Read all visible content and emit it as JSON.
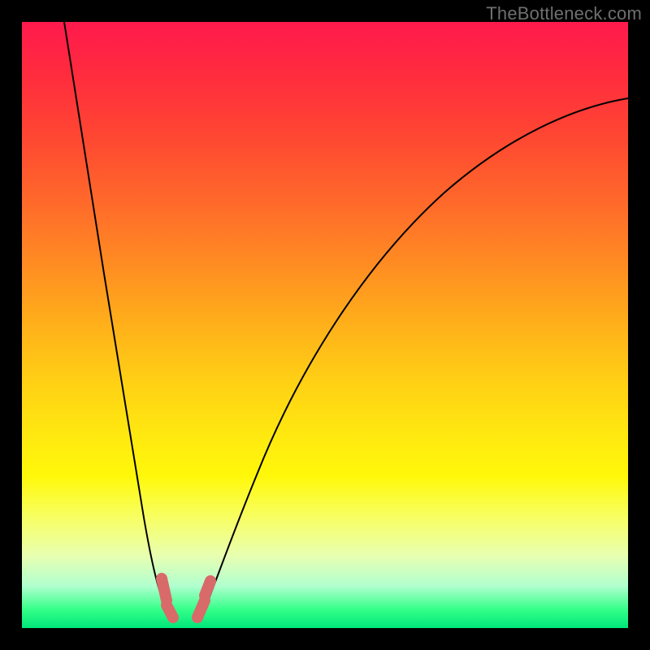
{
  "watermark": "TheBottleneck.com",
  "chart_data": {
    "type": "line",
    "title": "",
    "xlabel": "",
    "ylabel": "",
    "xlim": [
      0,
      100
    ],
    "ylim": [
      0,
      100
    ],
    "background_gradient": {
      "top": "#ff1a4d",
      "bottom": "#00e67a",
      "description": "vertical red-to-green heat gradient (high = bad / bottleneck, low = good)"
    },
    "series": [
      {
        "name": "left-branch",
        "x": [
          7,
          10,
          14,
          18,
          21,
          24,
          25
        ],
        "y": [
          100,
          78,
          50,
          25,
          10,
          3,
          1.5
        ]
      },
      {
        "name": "right-branch",
        "x": [
          29,
          32,
          38,
          48,
          60,
          75,
          90,
          100
        ],
        "y": [
          1.5,
          6,
          20,
          45,
          65,
          78,
          85,
          87
        ]
      }
    ],
    "annotations": [
      {
        "name": "optimal-region",
        "x_range": [
          23,
          31
        ],
        "y_range": [
          1,
          8
        ],
        "color": "#d96a6a",
        "description": "highlighted pink segment resting at the curve trough / bottom green band"
      }
    ],
    "note": "No axes, ticks, or numeric labels are rendered in the source image; all values are estimated from pixel positions relative to the 746x746 plot area."
  }
}
